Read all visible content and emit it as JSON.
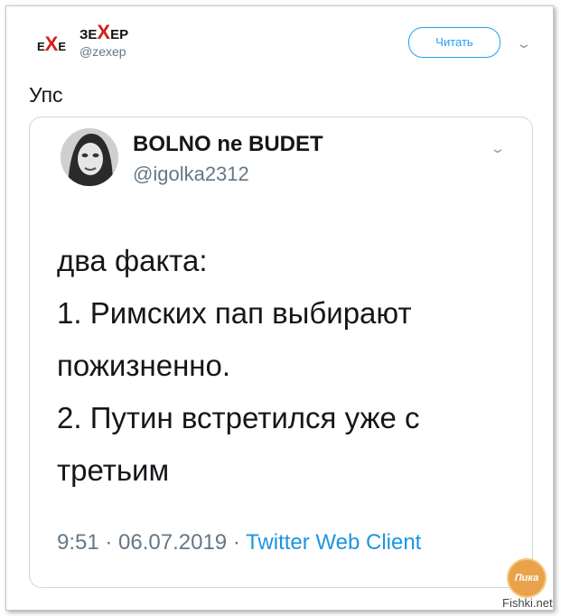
{
  "outer_tweet": {
    "avatar_logo": {
      "left": "E",
      "x": "X",
      "right": "E"
    },
    "display_name": {
      "prefix": "ЗЕ",
      "x": "X",
      "suffix": "ЕР"
    },
    "handle": "@zexep",
    "follow_label": "Читать",
    "text": "Упс"
  },
  "quoted_tweet": {
    "display_name": "BOLNO ne BUDET",
    "handle": "@igolka2312",
    "lines": [
      "два факта:",
      "1. Римских пап выбирают",
      "пожизненно.",
      "2. Путин встретился уже с",
      "третьим"
    ],
    "meta": {
      "time_date": "9:51 · 06.07.2019 · ",
      "source": "Twitter Web Client"
    }
  },
  "watermark": {
    "badge": "Пика",
    "text": "Fishki.net"
  },
  "colors": {
    "accent": "#1da1f2",
    "link": "#1b95e0",
    "muted": "#657786",
    "logo_x": "#d0201a"
  }
}
